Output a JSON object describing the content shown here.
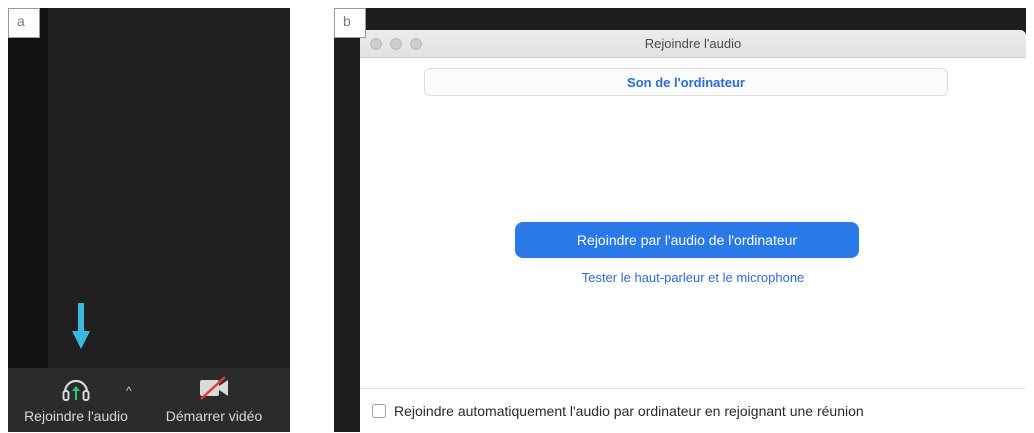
{
  "panel_a": {
    "tag": "a",
    "toolbar": {
      "join_audio_label": "Rejoindre l'audio",
      "start_video_label": "Démarrer vidéo",
      "caret": "^"
    },
    "colors": {
      "arrow": "#3bb8e0",
      "audio_icon_arrow": "#2ecc71",
      "video_slash": "#e53935"
    }
  },
  "panel_b": {
    "tag": "b",
    "window": {
      "title": "Rejoindre l'audio",
      "tab_label": "Son de l'ordinateur",
      "join_button_label": "Rejoindre par l'audio de l'ordinateur",
      "test_link_label": "Tester le haut-parleur et le microphone",
      "auto_join_checkbox": {
        "label": "Rejoindre automatiquement l'audio par ordinateur en rejoignant une réunion",
        "checked": false
      }
    },
    "colors": {
      "accent": "#2a79e8",
      "link": "#2d6bd6"
    }
  }
}
